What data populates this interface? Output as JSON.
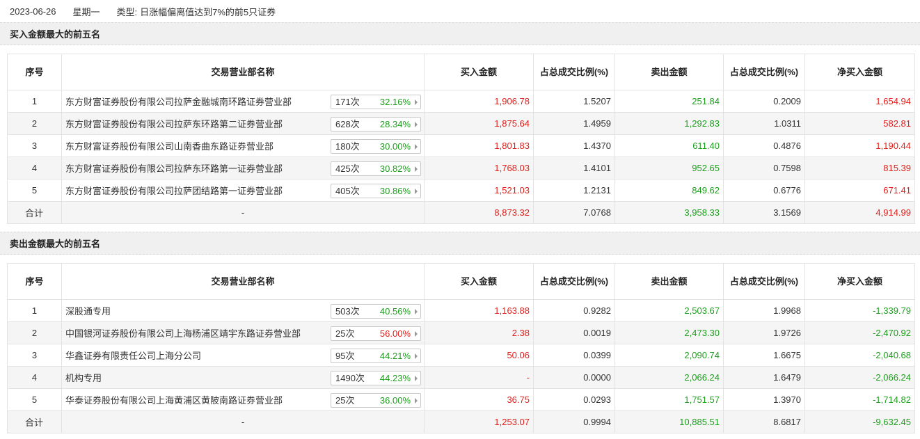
{
  "header": {
    "date": "2023-06-26",
    "weekday": "星期一",
    "type_label": "类型:",
    "type_value": "日涨幅偏离值达到7%的前5只证券"
  },
  "columns": {
    "idx": "序号",
    "name": "交易营业部名称",
    "buy": "买入金额",
    "buy_ratio": "占总成交比例(%)",
    "sell": "卖出金额",
    "sell_ratio": "占总成交比例(%)",
    "net": "净买入金额"
  },
  "colors": {
    "up": "#e0201c",
    "down": "#1d9e1d",
    "section_bg": "#f0f0f0"
  },
  "buy_section": {
    "title": "买入金额最大的前五名",
    "rows": [
      {
        "idx": "1",
        "name": "东方财富证券股份有限公司拉萨金融城南环路证券营业部",
        "count": "171次",
        "pct": "32.16%",
        "pct_color": "green",
        "buy": "1,906.78",
        "buy_ratio": "1.5207",
        "sell": "251.84",
        "sell_ratio": "0.2009",
        "net": "1,654.94",
        "net_color": "red"
      },
      {
        "idx": "2",
        "name": "东方财富证券股份有限公司拉萨东环路第二证券营业部",
        "count": "628次",
        "pct": "28.34%",
        "pct_color": "green",
        "buy": "1,875.64",
        "buy_ratio": "1.4959",
        "sell": "1,292.83",
        "sell_ratio": "1.0311",
        "net": "582.81",
        "net_color": "red"
      },
      {
        "idx": "3",
        "name": "东方财富证券股份有限公司山南香曲东路证券营业部",
        "count": "180次",
        "pct": "30.00%",
        "pct_color": "green",
        "buy": "1,801.83",
        "buy_ratio": "1.4370",
        "sell": "611.40",
        "sell_ratio": "0.4876",
        "net": "1,190.44",
        "net_color": "red"
      },
      {
        "idx": "4",
        "name": "东方财富证券股份有限公司拉萨东环路第一证券营业部",
        "count": "425次",
        "pct": "30.82%",
        "pct_color": "green",
        "buy": "1,768.03",
        "buy_ratio": "1.4101",
        "sell": "952.65",
        "sell_ratio": "0.7598",
        "net": "815.39",
        "net_color": "red"
      },
      {
        "idx": "5",
        "name": "东方财富证券股份有限公司拉萨团结路第一证券营业部",
        "count": "405次",
        "pct": "30.86%",
        "pct_color": "green",
        "buy": "1,521.03",
        "buy_ratio": "1.2131",
        "sell": "849.62",
        "sell_ratio": "0.6776",
        "net": "671.41",
        "net_color": "red"
      }
    ],
    "total": {
      "label": "合计",
      "name": "-",
      "buy": "8,873.32",
      "buy_ratio": "7.0768",
      "sell": "3,958.33",
      "sell_ratio": "3.1569",
      "net": "4,914.99",
      "net_color": "red"
    }
  },
  "sell_section": {
    "title": "卖出金额最大的前五名",
    "rows": [
      {
        "idx": "1",
        "name": "深股通专用",
        "count": "503次",
        "pct": "40.56%",
        "pct_color": "green",
        "buy": "1,163.88",
        "buy_ratio": "0.9282",
        "sell": "2,503.67",
        "sell_ratio": "1.9968",
        "net": "-1,339.79",
        "net_color": "green"
      },
      {
        "idx": "2",
        "name": "中国银河证券股份有限公司上海杨浦区靖宇东路证券营业部",
        "count": "25次",
        "pct": "56.00%",
        "pct_color": "red",
        "buy": "2.38",
        "buy_ratio": "0.0019",
        "sell": "2,473.30",
        "sell_ratio": "1.9726",
        "net": "-2,470.92",
        "net_color": "green"
      },
      {
        "idx": "3",
        "name": "华鑫证券有限责任公司上海分公司",
        "count": "95次",
        "pct": "44.21%",
        "pct_color": "green",
        "buy": "50.06",
        "buy_ratio": "0.0399",
        "sell": "2,090.74",
        "sell_ratio": "1.6675",
        "net": "-2,040.68",
        "net_color": "green"
      },
      {
        "idx": "4",
        "name": "机构专用",
        "count": "1490次",
        "pct": "44.23%",
        "pct_color": "green",
        "buy": "-",
        "buy_ratio": "0.0000",
        "sell": "2,066.24",
        "sell_ratio": "1.6479",
        "net": "-2,066.24",
        "net_color": "green"
      },
      {
        "idx": "5",
        "name": "华泰证券股份有限公司上海黄浦区黄陂南路证券营业部",
        "count": "25次",
        "pct": "36.00%",
        "pct_color": "green",
        "buy": "36.75",
        "buy_ratio": "0.0293",
        "sell": "1,751.57",
        "sell_ratio": "1.3970",
        "net": "-1,714.82",
        "net_color": "green"
      }
    ],
    "total": {
      "label": "合计",
      "name": "-",
      "buy": "1,253.07",
      "buy_ratio": "0.9994",
      "sell": "10,885.51",
      "sell_ratio": "8.6817",
      "net": "-9,632.45",
      "net_color": "green"
    }
  }
}
